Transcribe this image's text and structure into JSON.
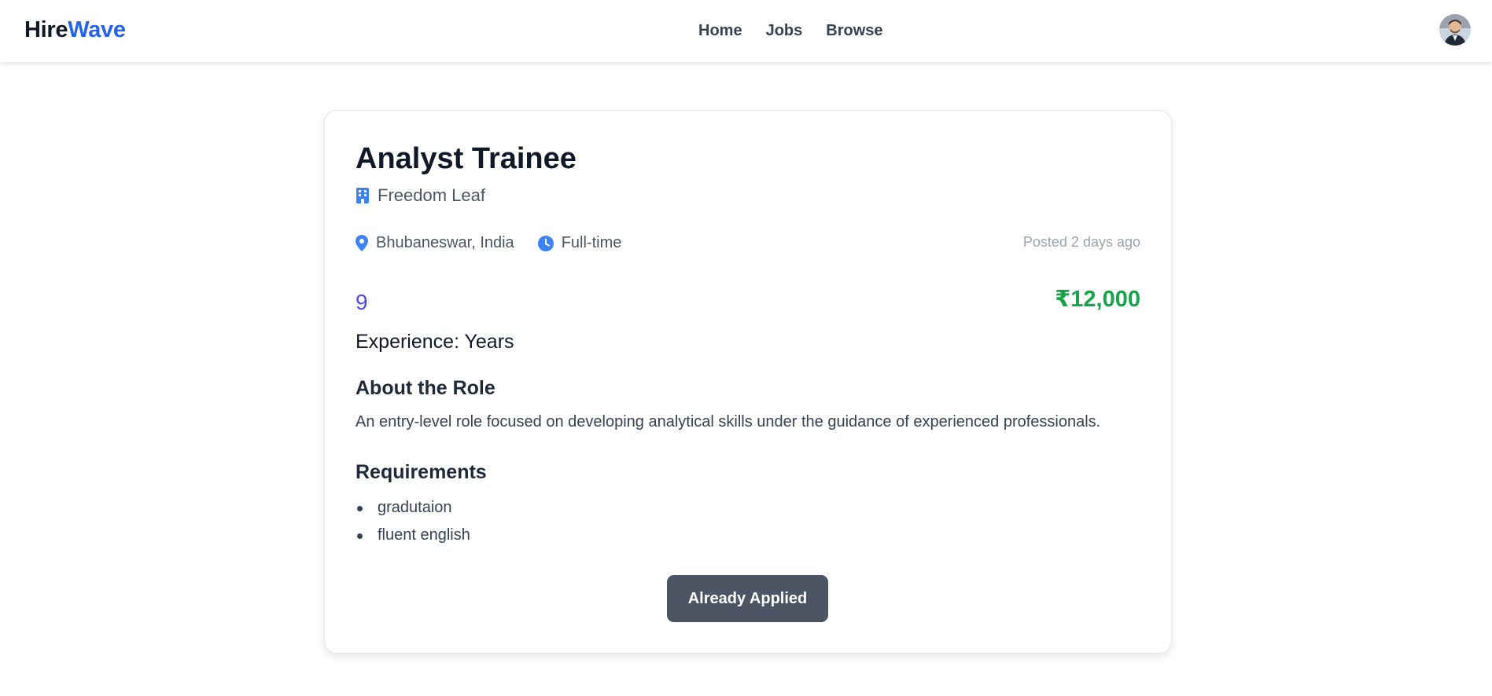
{
  "brand": {
    "part1": "Hire",
    "part2": "Wave"
  },
  "nav": {
    "links": [
      {
        "label": "Home"
      },
      {
        "label": "Jobs"
      },
      {
        "label": "Browse"
      }
    ]
  },
  "user": {
    "avatar_icon": "user-avatar"
  },
  "job": {
    "title": "Analyst Trainee",
    "company": "Freedom Leaf",
    "location": "Bhubaneswar, India",
    "job_type": "Full-time",
    "posted": "Posted 2 days ago",
    "experience_value": "9",
    "experience_label": "Experience: Years",
    "salary": "₹12,000",
    "about_title": "About the Role",
    "about_text": "An entry-level role focused on developing analytical skills under the guidance of experienced professionals.",
    "requirements_title": "Requirements",
    "requirements": [
      "gradutaion",
      "fluent english"
    ],
    "apply_label": "Already Applied"
  },
  "icons": {
    "company": "building-icon",
    "location": "map-pin-icon",
    "job_type": "clock-icon"
  },
  "colors": {
    "brand_accent": "#2563eb",
    "icon_blue": "#3b82f6",
    "salary_green": "#16a34a",
    "experience_indigo": "#4f46e5",
    "button_bg": "#4b5563"
  }
}
